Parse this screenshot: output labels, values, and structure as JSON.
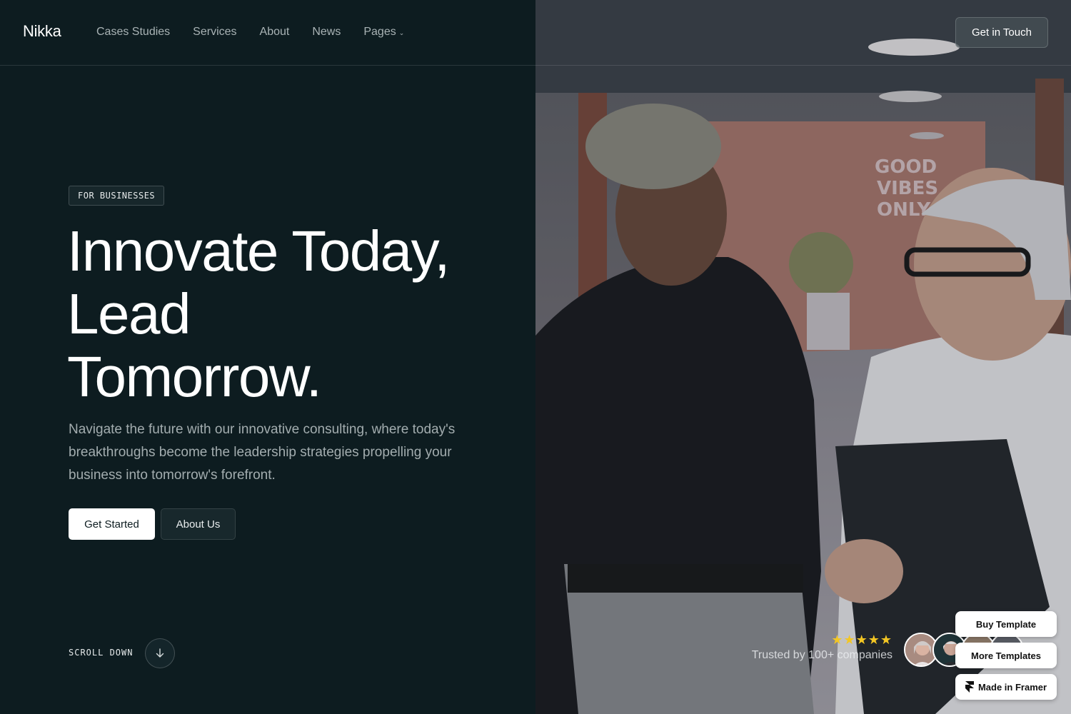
{
  "nav": {
    "logo": "Nikka",
    "links": [
      "Cases Studies",
      "Services",
      "About",
      "News",
      "Pages"
    ],
    "cta": "Get in Touch"
  },
  "hero": {
    "tag": "FOR BUSINESSES",
    "headline_lines": [
      "Innovate Today,",
      "Lead",
      "Tomorrow."
    ],
    "subtitle": "Navigate the future with our innovative consulting, where today's breakthroughs become the leadership strategies propelling your business into tomorrow's forefront.",
    "primary_button": "Get Started",
    "secondary_button": "About Us",
    "scroll_label": "SCROLL DOWN"
  },
  "trust": {
    "stars": "★★★★★",
    "text": "Trusted by 100+ companies"
  },
  "framer": {
    "buy": "Buy Template",
    "more": "More Templates",
    "made": "Made in Framer"
  },
  "colors": {
    "background": "#0d1c20",
    "star": "#f3c623",
    "text_muted": "#a3adaf"
  }
}
